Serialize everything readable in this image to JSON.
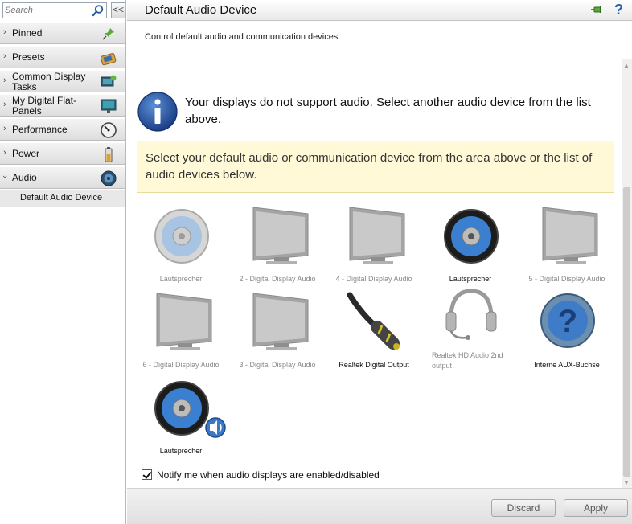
{
  "search": {
    "placeholder": "Search"
  },
  "sidebar": {
    "collapse_label": "<<",
    "items": [
      {
        "label": "Pinned",
        "icon": "pin-icon"
      },
      {
        "label": "Presets",
        "icon": "presets-icon"
      },
      {
        "label": "Common Display Tasks",
        "icon": "display-tasks-icon"
      },
      {
        "label": "My Digital Flat-Panels",
        "icon": "flat-panel-icon"
      },
      {
        "label": "Performance",
        "icon": "gauge-icon"
      },
      {
        "label": "Power",
        "icon": "battery-icon"
      },
      {
        "label": "Audio",
        "icon": "speaker-icon"
      }
    ],
    "subitem": "Default Audio Device"
  },
  "header": {
    "title": "Default Audio Device",
    "help": "?"
  },
  "main": {
    "subtitle": "Control default audio and communication devices.",
    "info": "Your displays do not support audio. Select another audio device from the list above.",
    "note": "Select your default audio or communication device from the area above or the list of audio devices below.",
    "devices": [
      {
        "label": "Lautsprecher",
        "icon": "speaker-icon",
        "active": false
      },
      {
        "label": "2 - Digital Display Audio",
        "icon": "monitor-icon",
        "active": false
      },
      {
        "label": "4 - Digital Display Audio",
        "icon": "monitor-icon",
        "active": false
      },
      {
        "label": "Lautsprecher",
        "icon": "speaker-icon",
        "active": true
      },
      {
        "label": "5 - Digital Display Audio",
        "icon": "monitor-icon",
        "active": false
      },
      {
        "label": "6 - Digital Display Audio",
        "icon": "monitor-icon",
        "active": false
      },
      {
        "label": "3 - Digital Display Audio",
        "icon": "monitor-icon",
        "active": false
      },
      {
        "label": "Realtek Digital Output",
        "icon": "optical-cable-icon",
        "active": true
      },
      {
        "label": "Realtek HD Audio 2nd output",
        "icon": "headset-icon",
        "active": false
      },
      {
        "label": "Interne AUX-Buchse",
        "icon": "help-speaker-icon",
        "active": true
      },
      {
        "label": "Lautsprecher",
        "icon": "default-speaker-icon",
        "active": true
      }
    ],
    "checkbox_label": "Notify me when audio displays are enabled/disabled",
    "checkbox_checked": true
  },
  "footer": {
    "discard": "Discard",
    "apply": "Apply"
  }
}
